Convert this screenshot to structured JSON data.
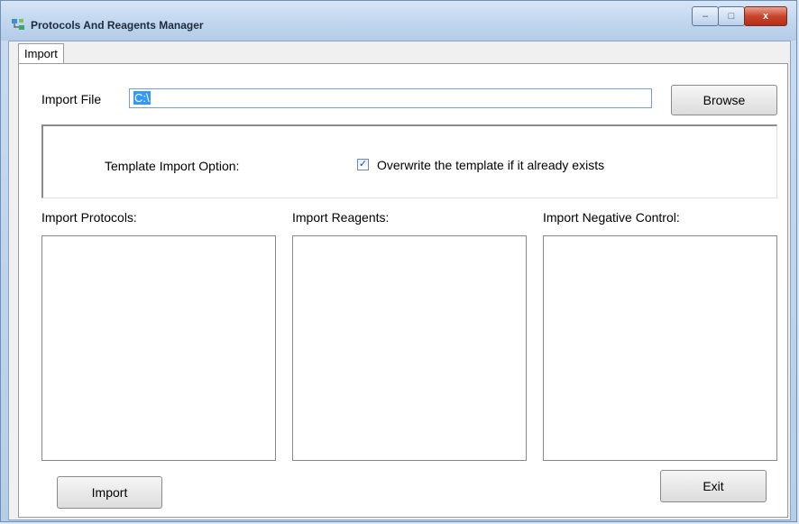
{
  "window": {
    "title": "Protocols And Reagents Manager",
    "close_glyph": "x",
    "min_glyph": "–",
    "max_glyph": "□"
  },
  "tabs": [
    {
      "label": "Import",
      "selected": true
    }
  ],
  "import_file": {
    "label": "Import File",
    "value": "C:\\",
    "browse_label": "Browse"
  },
  "template_option": {
    "label": "Template Import Option:",
    "checkbox_label": "Overwrite the template if it already exists",
    "checked": true,
    "check_glyph": "✓"
  },
  "lists": {
    "protocols_label": "Import Protocols:",
    "reagents_label": "Import Reagents:",
    "negative_control_label": "Import Negative Control:"
  },
  "buttons": {
    "import_label": "Import",
    "exit_label": "Exit"
  },
  "colors": {
    "title_bar": "#c4d8ef",
    "close_button": "#c8452b",
    "selection": "#3399ff"
  }
}
